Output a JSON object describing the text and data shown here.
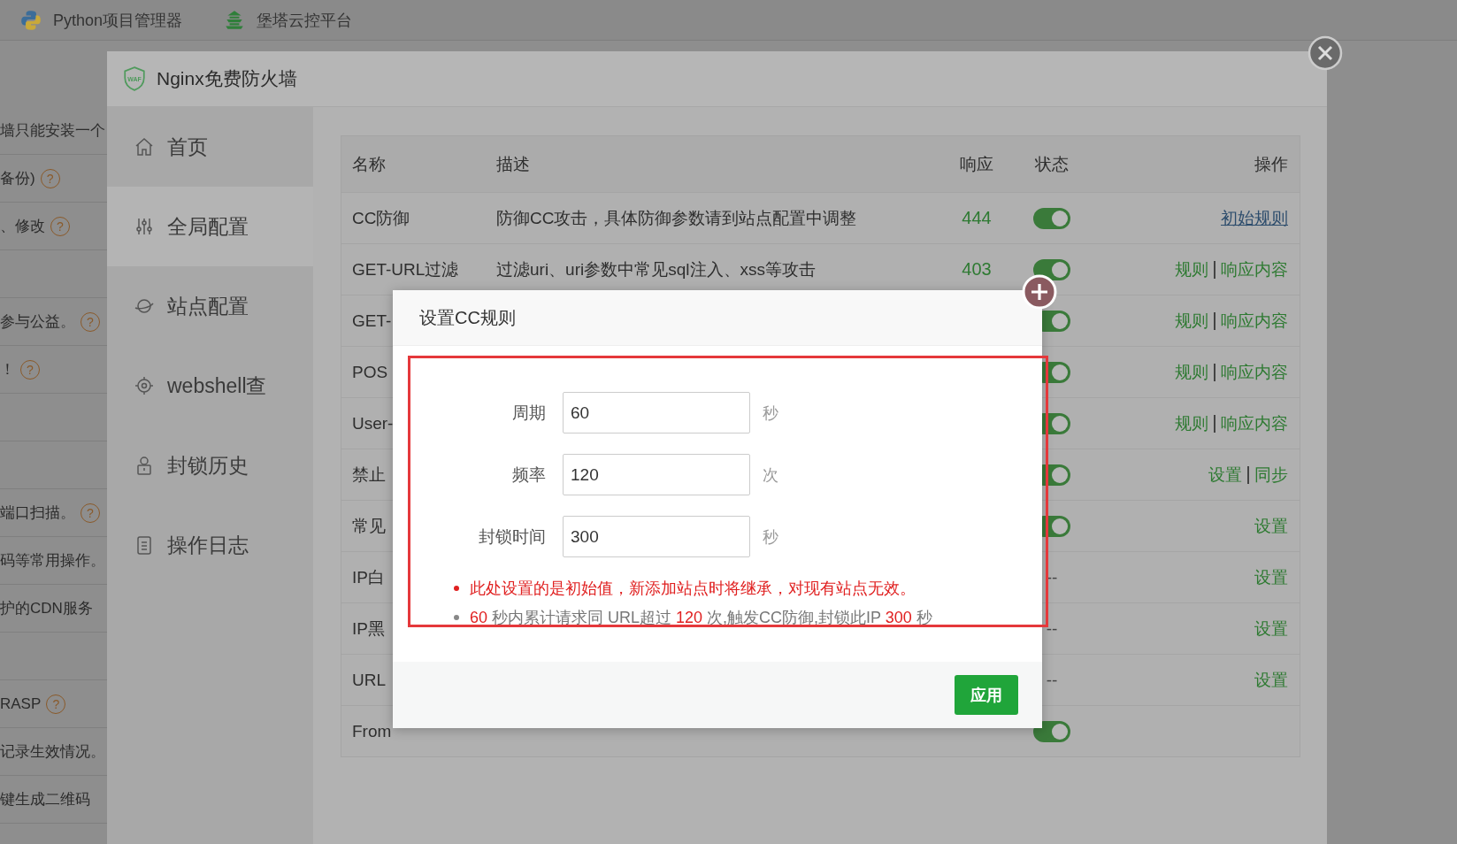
{
  "top_bar": {
    "items": [
      {
        "label": "Python项目管理器",
        "kind": "python"
      },
      {
        "label": "堡塔云控平台",
        "kind": "tower"
      }
    ]
  },
  "background_list": [
    {
      "kind": "text",
      "text": "墙只能安装一个"
    },
    {
      "kind": "text",
      "text": "备份)",
      "help": "?"
    },
    {
      "kind": "text",
      "text": "、修改",
      "help": "?"
    },
    {
      "kind": "spacer"
    },
    {
      "kind": "text",
      "text": "参与公益。",
      "help": "?"
    },
    {
      "kind": "text",
      "text": "！",
      "help": "?"
    },
    {
      "kind": "spacer"
    },
    {
      "kind": "spacer"
    },
    {
      "kind": "text",
      "text": "端口扫描。",
      "help": "?"
    },
    {
      "kind": "text",
      "text": "码等常用操作。"
    },
    {
      "kind": "text",
      "text": "护的CDN服务"
    },
    {
      "kind": "spacer"
    },
    {
      "kind": "text",
      "text": "RASP",
      "help": "?"
    },
    {
      "kind": "text",
      "text": "记录生效情况。"
    },
    {
      "kind": "text",
      "text": "键生成二维码"
    }
  ],
  "waf_window": {
    "logo": "WAF",
    "title": "Nginx免费防火墙",
    "sidebar": [
      {
        "label": "首页",
        "kind": "home",
        "selected": false
      },
      {
        "label": "全局配置",
        "kind": "sliders",
        "selected": true
      },
      {
        "label": "站点配置",
        "kind": "planet",
        "selected": false
      },
      {
        "label": "webshell查",
        "kind": "target",
        "selected": false
      },
      {
        "label": "封锁历史",
        "kind": "lock",
        "selected": false
      },
      {
        "label": "操作日志",
        "kind": "log",
        "selected": false
      }
    ],
    "table": {
      "columns": [
        "名称",
        "描述",
        "响应",
        "状态",
        "操作"
      ],
      "rows": [
        {
          "name": "CC防御",
          "description": "防御CC攻击，具体防御参数请到站点配置中调整",
          "response": "444",
          "status": {
            "kind": "toggle",
            "on": true
          },
          "actions": [
            {
              "label": "初始规则",
              "kind": "underline"
            }
          ]
        },
        {
          "name": "GET-URL过滤",
          "description": "过滤uri、uri参数中常见sql注入、xss等攻击",
          "response": "403",
          "status": {
            "kind": "toggle",
            "on": true
          },
          "actions": [
            {
              "label": "规则",
              "kind": "link"
            },
            {
              "label": "响应内容",
              "kind": "link"
            }
          ]
        },
        {
          "name": "GET-",
          "status": {
            "kind": "toggle",
            "on": true
          },
          "actions": [
            {
              "label": "规则",
              "kind": "link"
            },
            {
              "label": "响应内容",
              "kind": "link"
            }
          ]
        },
        {
          "name": "POS",
          "status": {
            "kind": "toggle",
            "on": true
          },
          "actions": [
            {
              "label": "规则",
              "kind": "link"
            },
            {
              "label": "响应内容",
              "kind": "link"
            }
          ]
        },
        {
          "name": "User-",
          "status": {
            "kind": "toggle",
            "on": true
          },
          "actions": [
            {
              "label": "规则",
              "kind": "link"
            },
            {
              "label": "响应内容",
              "kind": "link"
            }
          ]
        },
        {
          "name": "禁止",
          "status": {
            "kind": "toggle",
            "on": true
          },
          "actions": [
            {
              "label": "设置",
              "kind": "link"
            },
            {
              "label": "同步",
              "kind": "link"
            }
          ]
        },
        {
          "name": "常见",
          "status": {
            "kind": "toggle",
            "on": true
          },
          "actions": [
            {
              "label": "设置",
              "kind": "link"
            }
          ]
        },
        {
          "name": "IP白",
          "status": {
            "kind": "text",
            "text": "--"
          },
          "actions": [
            {
              "label": "设置",
              "kind": "link"
            }
          ]
        },
        {
          "name": "IP黑",
          "status": {
            "kind": "text",
            "text": "--"
          },
          "actions": [
            {
              "label": "设置",
              "kind": "link"
            }
          ]
        },
        {
          "name": "URL",
          "status": {
            "kind": "text",
            "text": "--"
          },
          "actions": [
            {
              "label": "设置",
              "kind": "link"
            }
          ]
        },
        {
          "name": "From",
          "status": {
            "kind": "toggle",
            "on": true
          },
          "actions": []
        }
      ]
    }
  },
  "dialog": {
    "title": "设置CC规则",
    "fields": [
      {
        "label": "周期",
        "value": "60",
        "unit": "秒"
      },
      {
        "label": "频率",
        "value": "120",
        "unit": "次"
      },
      {
        "label": "封锁时间",
        "value": "300",
        "unit": "秒"
      }
    ],
    "notes": [
      {
        "kind": "warning",
        "parts": [
          {
            "text": "此处设置的是初始值，新添加站点时将继承，对现有站点无效。",
            "emphasis": true
          }
        ]
      },
      {
        "kind": "info",
        "parts": [
          {
            "text": "60",
            "emphasis": true
          },
          {
            "text": " 秒内累计请求同 URL超过 ",
            "emphasis": false
          },
          {
            "text": "120",
            "emphasis": true
          },
          {
            "text": " 次,触发CC防御,封锁此IP ",
            "emphasis": false
          },
          {
            "text": "300",
            "emphasis": true
          },
          {
            "text": " 秒",
            "emphasis": false
          }
        ]
      }
    ],
    "apply_button": "应用"
  }
}
